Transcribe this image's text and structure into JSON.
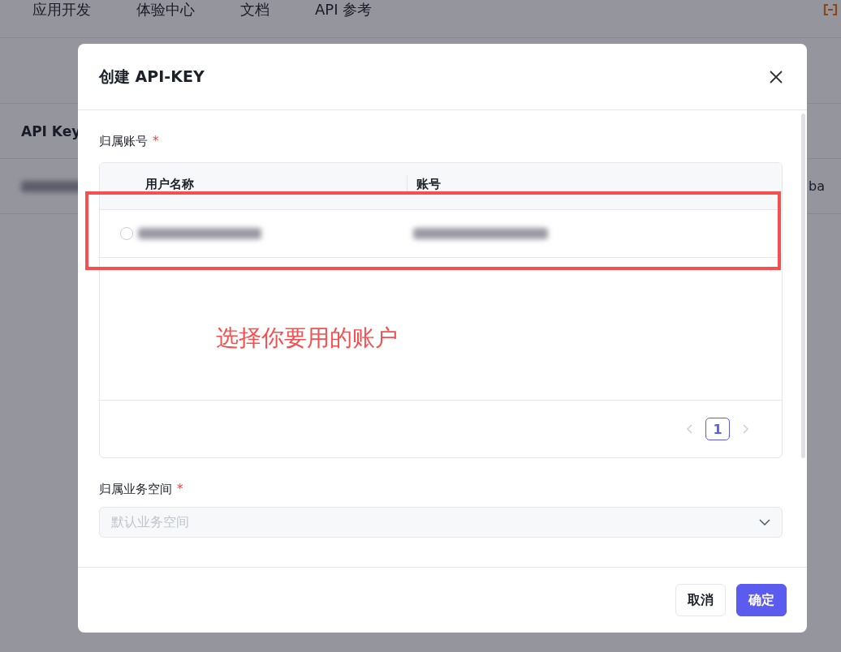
{
  "nav": {
    "items": [
      "应用开发",
      "体验中心",
      "文档",
      "API 参考"
    ]
  },
  "background_table": {
    "header": "API Key",
    "row_tail": "ba"
  },
  "dialog": {
    "title": "创建 API-KEY",
    "account_field": {
      "label": "归属账号",
      "required_mark": "*",
      "columns": [
        "用户名称",
        "账号"
      ],
      "rows": [
        {
          "selected": false
        }
      ]
    },
    "pagination": {
      "pages": [
        {
          "label": "1",
          "selected": true
        }
      ]
    },
    "workspace_field": {
      "label": "归属业务空间",
      "required_mark": "*",
      "placeholder": "默认业务空间",
      "disabled": true
    },
    "buttons": [
      {
        "label": "取消",
        "kind": "secondary"
      },
      {
        "label": "确定",
        "kind": "primary"
      }
    ]
  },
  "annotation": {
    "text": "选择你要用的账户",
    "color": "#f5504f"
  }
}
